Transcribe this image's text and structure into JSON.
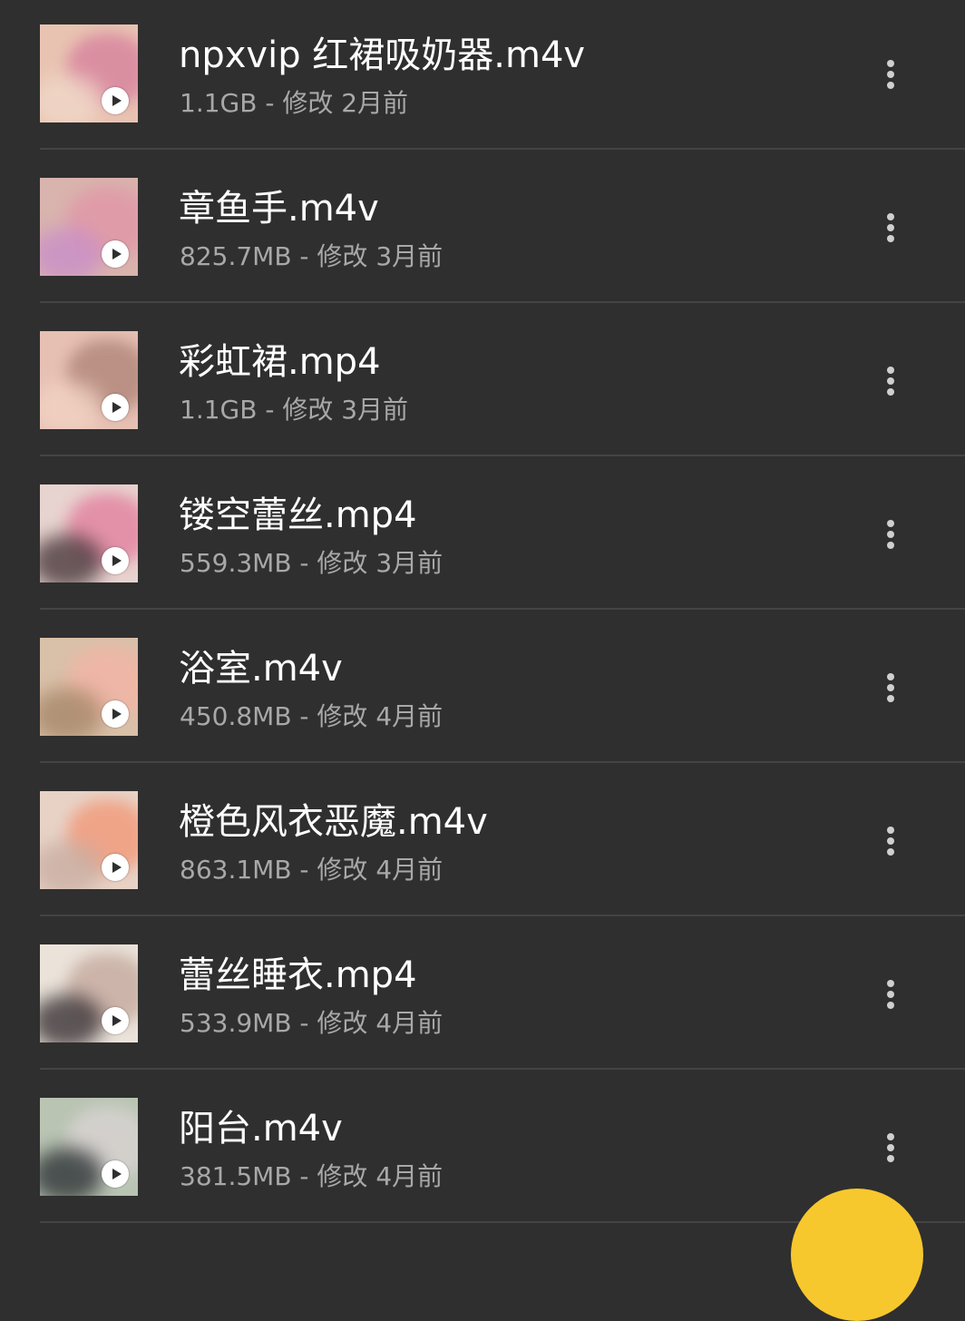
{
  "theme": {
    "background": "#2f2f2f",
    "text_primary": "#ffffff",
    "text_secondary": "#a8a8a8",
    "divider": "#444444",
    "fab_color": "#f7c82d"
  },
  "files": [
    {
      "name": "npxvip 红裙吸奶器.m4v",
      "meta": "1.1GB - 修改 2月前",
      "thumb_colors": [
        "#e9c3b2",
        "#d98aa0",
        "#f0d8c8"
      ]
    },
    {
      "name": "章鱼手.m4v",
      "meta": "825.7MB - 修改 3月前",
      "thumb_colors": [
        "#d9b3ad",
        "#e09aa8",
        "#c98fc9"
      ]
    },
    {
      "name": "彩虹裙.mp4",
      "meta": "1.1GB - 修改 3月前",
      "thumb_colors": [
        "#e6c0b3",
        "#b68c80",
        "#f2d2c3"
      ]
    },
    {
      "name": "镂空蕾丝.mp4",
      "meta": "559.3MB - 修改 3月前",
      "thumb_colors": [
        "#e7d3cf",
        "#e38aa4",
        "#4b3a3e"
      ]
    },
    {
      "name": "浴室.m4v",
      "meta": "450.8MB - 修改 4月前",
      "thumb_colors": [
        "#d9c0a8",
        "#f0b6a6",
        "#a7886b"
      ]
    },
    {
      "name": "橙色风衣恶魔.m4v",
      "meta": "863.1MB - 修改 4月前",
      "thumb_colors": [
        "#e8d2c6",
        "#f0a082",
        "#c9aea3"
      ]
    },
    {
      "name": "蕾丝睡衣.mp4",
      "meta": "533.9MB - 修改 4月前",
      "thumb_colors": [
        "#ebe3da",
        "#c9b0a5",
        "#3a3336"
      ]
    },
    {
      "name": "阳台.m4v",
      "meta": "381.5MB - 修改 4月前",
      "thumb_colors": [
        "#b9c4b3",
        "#d6d2cf",
        "#2f3437"
      ]
    }
  ],
  "icons": {
    "play": "play-icon",
    "more": "more-vert-icon",
    "fab": "floating-action-button"
  }
}
